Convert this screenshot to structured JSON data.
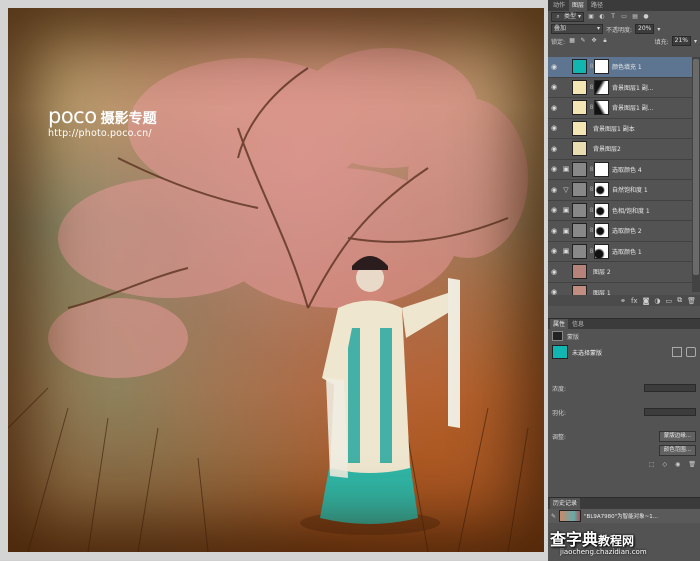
{
  "watermark": {
    "logo": "poco",
    "subtitle": "摄影专题",
    "url": "http://photo.poco.cn/"
  },
  "panel_tabs": [
    "动作",
    "图层",
    "路径"
  ],
  "layers_toolbar": {
    "kind_filter": "类型",
    "blend_mode": "叠加",
    "opacity_label": "不透明度:",
    "opacity_value": "20%",
    "lock_label": "锁定:",
    "fill_label": "填充:",
    "fill_value": "21%"
  },
  "layers": [
    {
      "name": "颜色填充 1",
      "type": "fill",
      "selected": true,
      "thumb_color": "#11b6b0",
      "mask": "white"
    },
    {
      "name": "背景图层1 副...",
      "type": "masked",
      "selected": false,
      "thumb_color": "#f4e6b4",
      "mask": "partial"
    },
    {
      "name": "背景图层1 副...",
      "type": "masked",
      "selected": false,
      "thumb_color": "#f4e6b4",
      "mask": "partial2"
    },
    {
      "name": "背景图层1 副本",
      "type": "plain",
      "selected": false,
      "thumb_color": "#f4e6b4",
      "mask": ""
    },
    {
      "name": "背景图层2",
      "type": "plain",
      "selected": false,
      "thumb_color": "#e8ddb0",
      "mask": ""
    },
    {
      "name": "选取颜色 4",
      "type": "adjust",
      "selected": false,
      "thumb_color": "#888888",
      "mask": "white"
    },
    {
      "name": "自然饱和度 1",
      "type": "adjust-vib",
      "selected": false,
      "thumb_color": "#888888",
      "mask": "dark-fig"
    },
    {
      "name": "色相/饱和度 1",
      "type": "adjust",
      "selected": false,
      "thumb_color": "#888888",
      "mask": "dark-fig"
    },
    {
      "name": "选取颜色 2",
      "type": "adjust",
      "selected": false,
      "thumb_color": "#888888",
      "mask": "dark-fig"
    },
    {
      "name": "选取颜色 1",
      "type": "adjust",
      "selected": false,
      "thumb_color": "#888888",
      "mask": "dark-fig2"
    },
    {
      "name": "图层 2",
      "type": "image",
      "selected": false,
      "thumb_color": "#b5837a",
      "mask": ""
    },
    {
      "name": "图层 1",
      "type": "image",
      "selected": false,
      "thumb_color": "#c08d80",
      "mask": ""
    }
  ],
  "layer_footer_icons": [
    "link-icon",
    "fx-icon",
    "mask-icon",
    "adjustment-icon",
    "folder-icon",
    "new-layer-icon",
    "trash-icon"
  ],
  "properties": {
    "tabs": [
      "属性",
      "信息"
    ],
    "section_label": "蒙版",
    "mask_status": "未选择蒙版",
    "density_label": "浓度:",
    "feather_label": "羽化:",
    "adjust_label": "调整:",
    "btn_mask_edge": "蒙版边缘...",
    "btn_color_range": "颜色范围..."
  },
  "history": {
    "tab": "历史记录",
    "item": "\"BL9A7980\"为智能对象~1..."
  },
  "site_watermark": {
    "brand": "查字典",
    "suffix": "教程网",
    "url": "jiaocheng.chazidian.com"
  },
  "colors": {
    "panel_bg": "#535353",
    "selection": "#5d7591",
    "fill_teal": "#11b6b0"
  }
}
